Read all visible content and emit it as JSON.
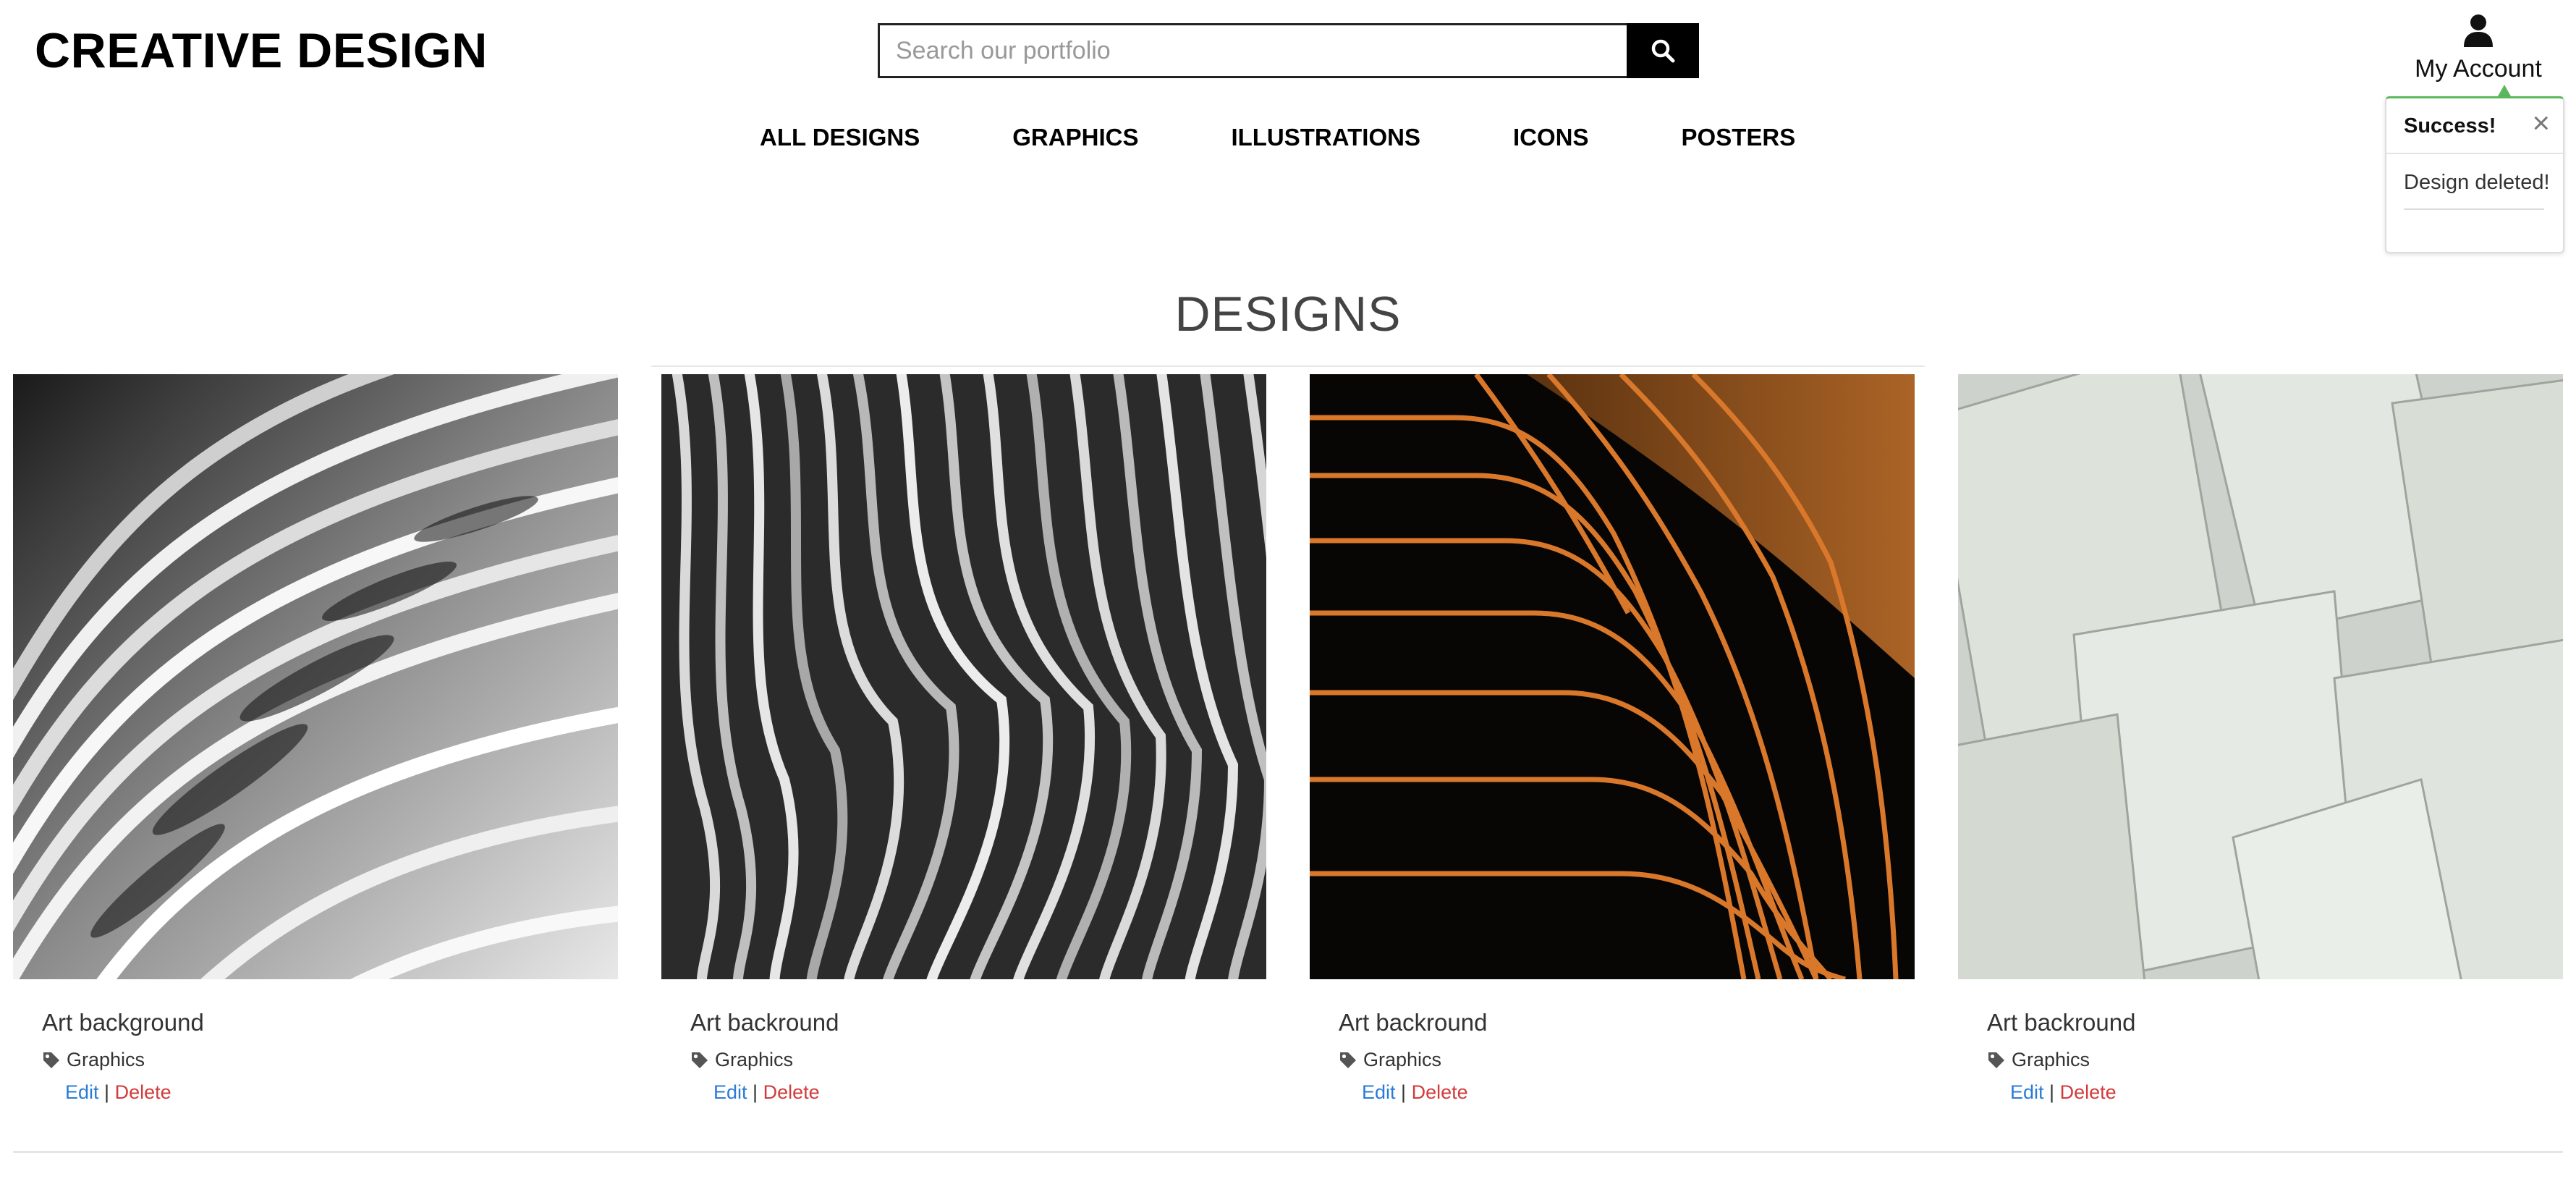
{
  "header": {
    "brand": "CREATIVE DESIGN",
    "search": {
      "placeholder": "Search our portfolio",
      "value": ""
    },
    "search_button_icon": "search-icon",
    "account": {
      "icon": "user-icon",
      "label": "My Account"
    }
  },
  "nav": {
    "items": [
      {
        "label": "ALL DESIGNS"
      },
      {
        "label": "GRAPHICS"
      },
      {
        "label": "ILLUSTRATIONS"
      },
      {
        "label": "ICONS"
      },
      {
        "label": "POSTERS"
      }
    ]
  },
  "toast": {
    "title": "Success!",
    "close": "×",
    "message": "Design deleted!",
    "accent": "#5cb85c"
  },
  "main": {
    "heading": "DESIGNS",
    "cards": [
      {
        "title": "Art background",
        "category": "Graphics",
        "edit": "Edit",
        "separator": "|",
        "delete": "Delete",
        "image": "abstract-white-waves"
      },
      {
        "title": "Art backround",
        "category": "Graphics",
        "edit": "Edit",
        "separator": "|",
        "delete": "Delete",
        "image": "abstract-grey-ridges"
      },
      {
        "title": "Art backround",
        "category": "Graphics",
        "edit": "Edit",
        "separator": "|",
        "delete": "Delete",
        "image": "abstract-orange-lines"
      },
      {
        "title": "Art backround",
        "category": "Graphics",
        "edit": "Edit",
        "separator": "|",
        "delete": "Delete",
        "image": "abstract-paper-sheets"
      }
    ]
  },
  "colors": {
    "edit_link": "#2a7bd6",
    "delete_link": "#d23b3b"
  }
}
